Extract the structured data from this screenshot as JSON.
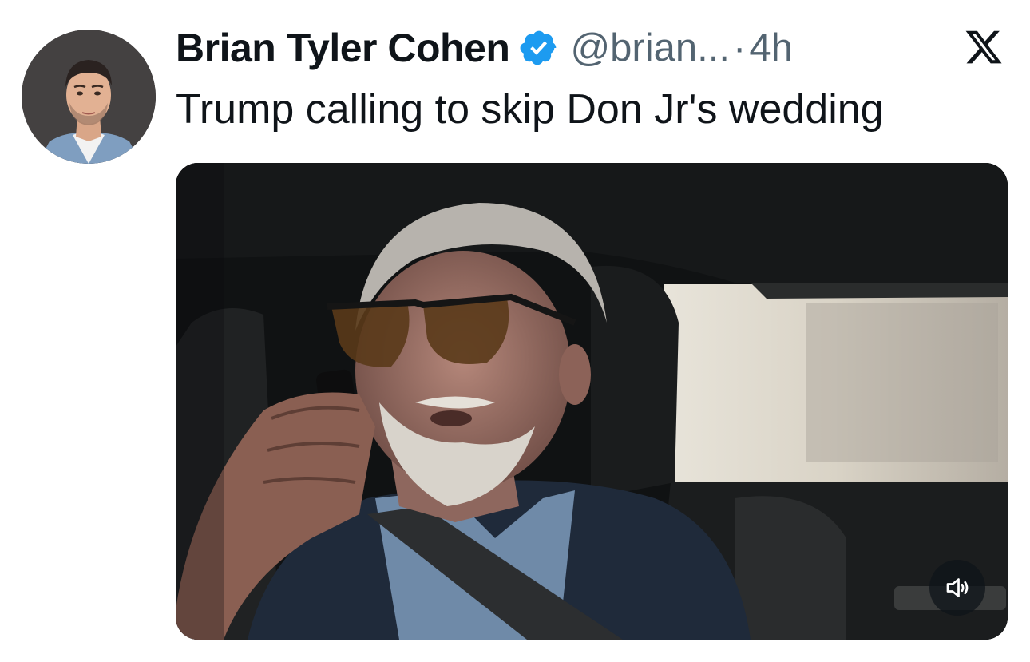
{
  "author": {
    "name": "Brian Tyler Cohen",
    "handle": "@brian...",
    "separator": "·",
    "time": "4h",
    "verified": true,
    "avatar_icon": "profile-photo"
  },
  "post": {
    "text": "Trump calling to skip Don Jr's wedding"
  },
  "media": {
    "type": "video",
    "sound_icon": "speaker-icon"
  },
  "branding": {
    "logo_icon": "x-logo-icon"
  },
  "colors": {
    "verified_badge": "#1d9bf0",
    "secondary_text": "#536471",
    "primary_text": "#0f1419"
  }
}
